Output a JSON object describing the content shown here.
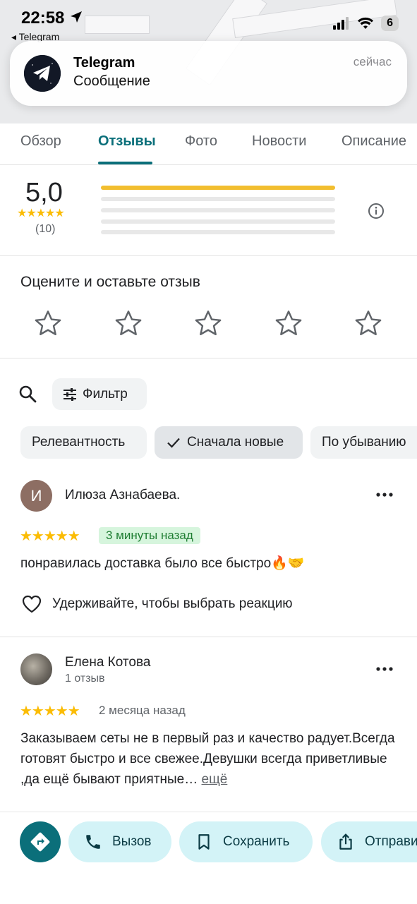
{
  "status_bar": {
    "time": "22:58",
    "back_app": "◂ Telegram",
    "battery": "6"
  },
  "notification": {
    "app": "Telegram",
    "message": "Сообщение",
    "time": "сейчас"
  },
  "tabs": [
    {
      "label": "Обзор",
      "active": false
    },
    {
      "label": "Отзывы",
      "active": true
    },
    {
      "label": "Фото",
      "active": false
    },
    {
      "label": "Новости",
      "active": false
    },
    {
      "label": "Описание",
      "active": false
    }
  ],
  "rating_summary": {
    "average": "5,0",
    "stars": "★★★★★",
    "count": "(10)",
    "distribution": [
      1.0,
      0,
      0,
      0,
      0
    ]
  },
  "rate": {
    "title": "Оцените и оставьте отзыв",
    "stars_total": 5
  },
  "filters": {
    "filter_label": "Фильтр",
    "sort_chips": [
      {
        "label": "Релевантность",
        "selected": false
      },
      {
        "label": "Сначала новые",
        "selected": true
      },
      {
        "label": "По убыванию",
        "selected": false
      }
    ]
  },
  "reviews": [
    {
      "avatar_letter": "И",
      "name": "Илюза Азнабаева.",
      "stars": "★★★★★",
      "time": "3 минуты назад",
      "text": "понравилась доставка было все быстро🔥🤝",
      "reaction_hint": "Удерживайте, чтобы выбрать реакцию"
    },
    {
      "name": "Елена Котова",
      "subtitle": "1 отзыв",
      "stars": "★★★★★",
      "time": "2 месяца назад",
      "text": "Заказываем сеты не в первый раз и качество радует.Всегда готовят быстро и  все свежее.Девушки всегда приветливые ,да ещё бывают приятные…",
      "more": "ещё"
    }
  ],
  "actions": {
    "call": "Вызов",
    "save": "Сохранить",
    "share": "Отправить"
  },
  "colors": {
    "accent": "#0b6f7a",
    "star": "#fbbc04",
    "chip_bg": "#f1f3f4",
    "action_bg": "#d3f3f7"
  }
}
